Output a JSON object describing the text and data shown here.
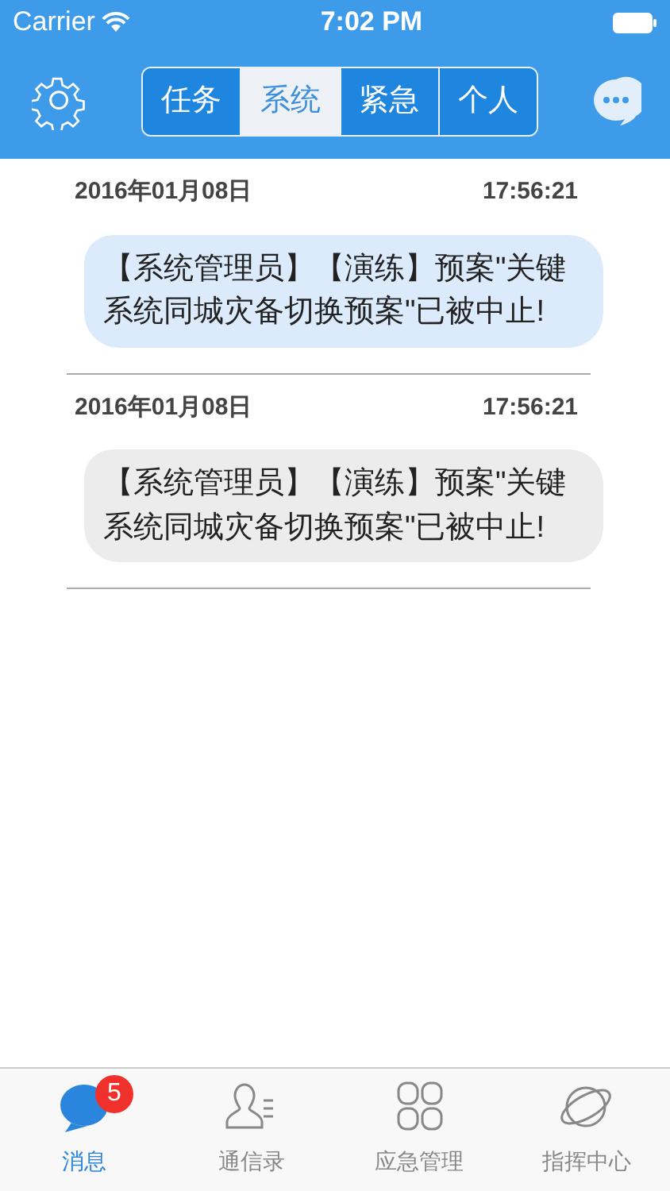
{
  "status_bar": {
    "carrier": "Carrier",
    "time": "7:02 PM"
  },
  "tabs": [
    {
      "label": "任务",
      "selected": false
    },
    {
      "label": "系统",
      "selected": true
    },
    {
      "label": "紧急",
      "selected": false
    },
    {
      "label": "个人",
      "selected": false
    }
  ],
  "messages": [
    {
      "date": "2016年01月08日",
      "time": "17:56:21",
      "text": "【系统管理员】【演练】预案\"关键系统同城灾备切换预案\"已被中止!",
      "unread": true
    },
    {
      "date": "2016年01月08日",
      "time": "17:56:21",
      "text": "【系统管理员】【演练】预案\"关键系统同城灾备切换预案\"已被中止!",
      "unread": false
    }
  ],
  "tab_bar": [
    {
      "label": "消息",
      "selected": true,
      "badge": "5"
    },
    {
      "label": "通信录",
      "selected": false
    },
    {
      "label": "应急管理",
      "selected": false
    },
    {
      "label": "指挥中心",
      "selected": false
    }
  ]
}
